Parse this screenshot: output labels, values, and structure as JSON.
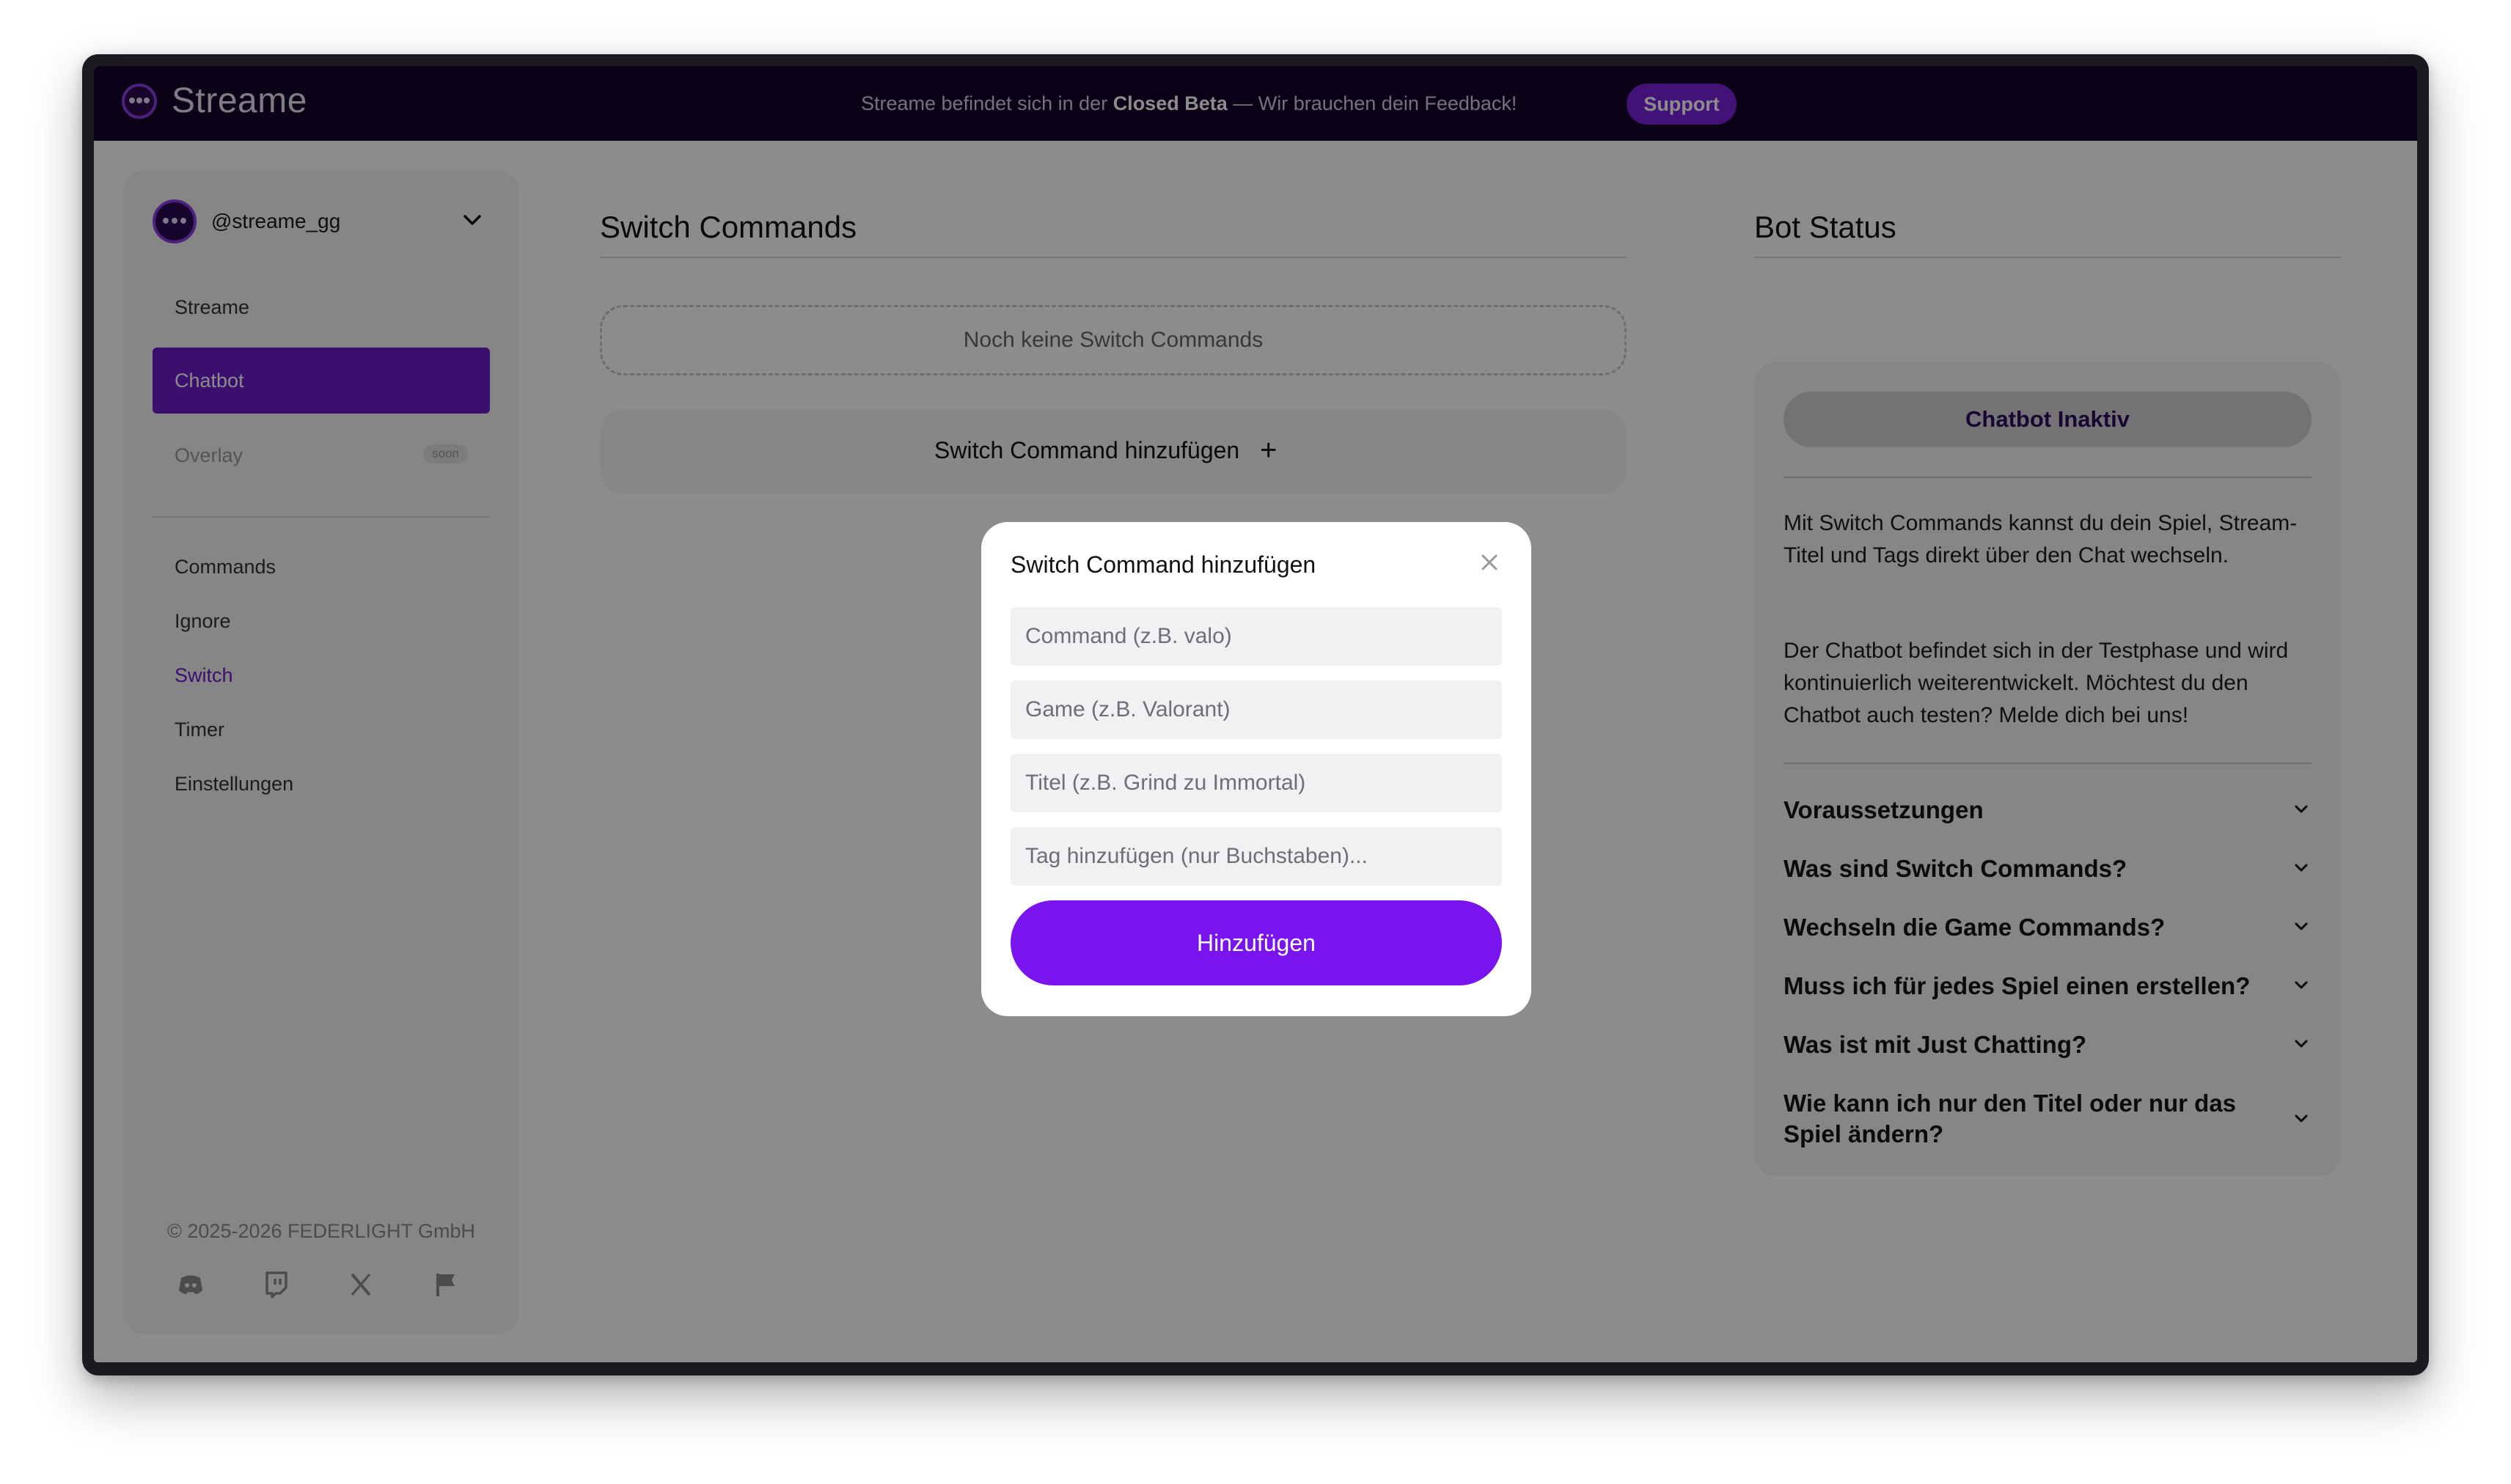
{
  "topbar": {
    "brand": "Streame",
    "beta_prefix": "Streame befindet sich in der ",
    "beta_bold": "Closed Beta",
    "beta_suffix": " — Wir brauchen dein Feedback!",
    "support_label": "Support"
  },
  "sidebar": {
    "account_name": "@streame_gg",
    "nav": [
      {
        "label": "Streame"
      },
      {
        "label": "Chatbot"
      },
      {
        "label": "Overlay",
        "badge": "soon"
      }
    ],
    "subnav": [
      {
        "label": "Commands"
      },
      {
        "label": "Ignore"
      },
      {
        "label": "Switch"
      },
      {
        "label": "Timer"
      },
      {
        "label": "Einstellungen"
      }
    ],
    "copyright": "© 2025-2026 FEDERLIGHT GmbH",
    "social_icons": [
      "discord-icon",
      "twitch-icon",
      "x-icon",
      "flag-icon"
    ]
  },
  "main": {
    "title": "Switch Commands",
    "empty_text": "Noch keine Switch Commands",
    "add_label": "Switch Command hinzufügen",
    "add_icon": "+"
  },
  "bot_status": {
    "title": "Bot Status",
    "status_label": "Chatbot Inaktiv",
    "paragraph1": "Mit Switch Commands kannst du dein Spiel, Stream-Titel und Tags direkt über den Chat wechseln.",
    "paragraph2": "Der Chatbot befindet sich in der Testphase und wird kontinuierlich weiterentwickelt. Möchtest du den Chatbot auch testen? Melde dich bei uns!",
    "faq": [
      {
        "q": "Voraussetzungen"
      },
      {
        "q": "Was sind Switch Commands?"
      },
      {
        "q": "Wechseln die Game Commands?"
      },
      {
        "q": "Muss ich für jedes Spiel einen erstellen?"
      },
      {
        "q": "Was ist mit Just Chatting?"
      },
      {
        "q": "Wie kann ich nur den Titel oder nur das Spiel ändern?"
      }
    ]
  },
  "modal": {
    "title": "Switch Command hinzufügen",
    "fields": {
      "command_placeholder": "Command (z.B. valo)",
      "game_placeholder": "Game (z.B. Valorant)",
      "title_placeholder": "Titel (z.B. Grind zu Immortal)",
      "tag_placeholder": "Tag hinzufügen (nur Buchstaben)..."
    },
    "submit_label": "Hinzufügen"
  },
  "colors": {
    "brand_purple": "#7a14ef",
    "active_nav": "#6a1cc8",
    "topbar_bg": "#15052c"
  }
}
